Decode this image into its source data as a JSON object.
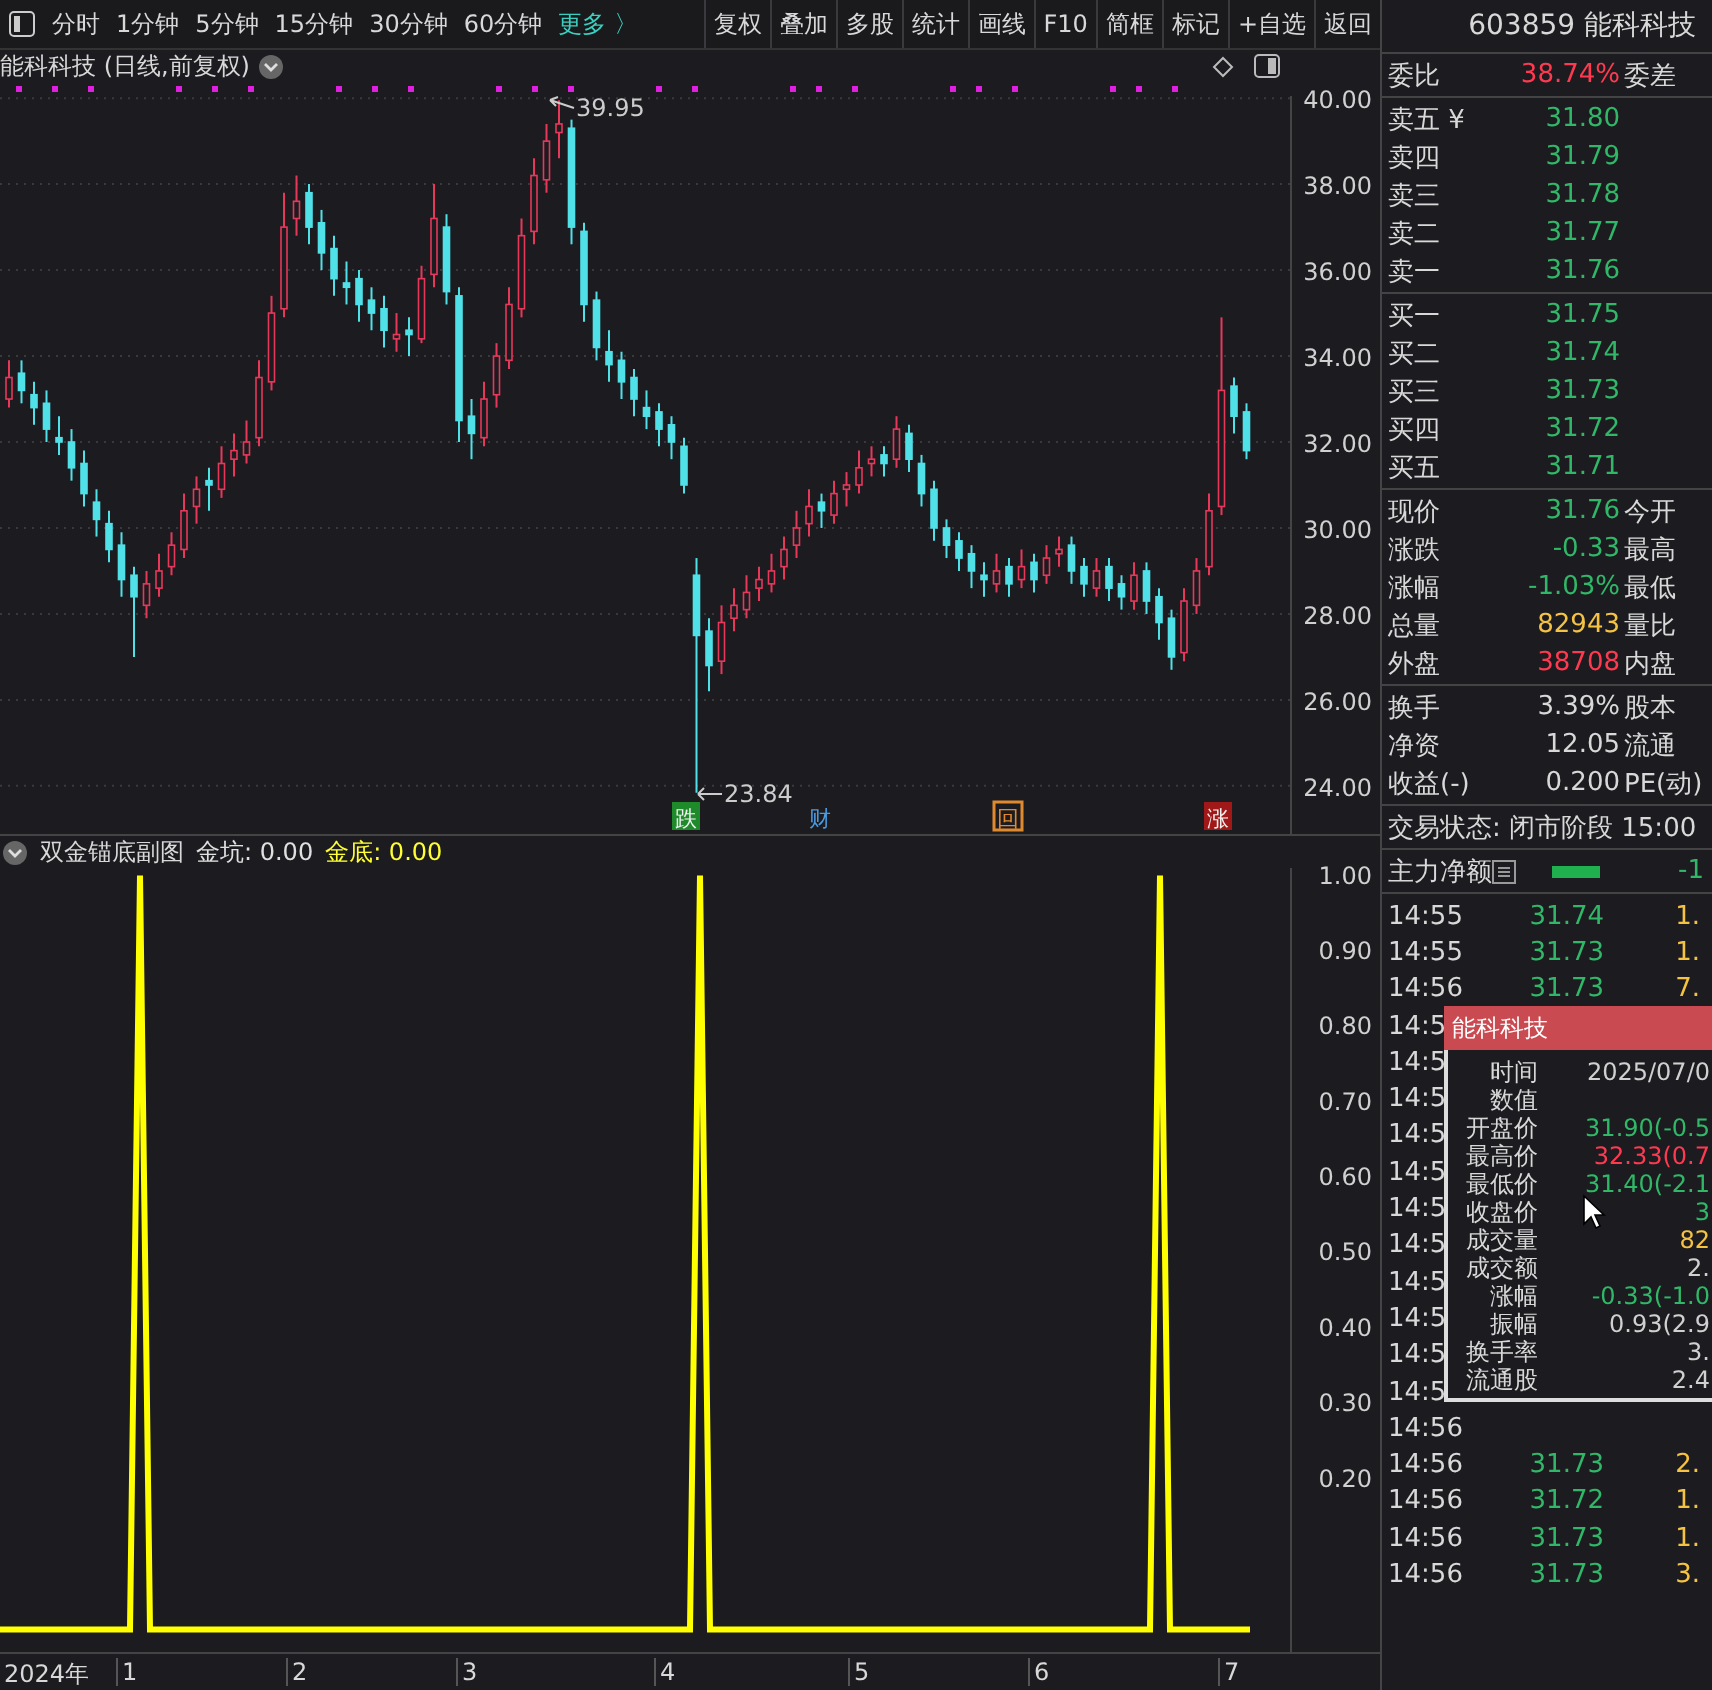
{
  "toolbar": {
    "periods": [
      {
        "label": "分时",
        "kind": "period"
      },
      {
        "label": "1分钟",
        "kind": "period"
      },
      {
        "label": "5分钟",
        "kind": "period"
      },
      {
        "label": "15分钟",
        "kind": "period"
      },
      {
        "label": "30分钟",
        "kind": "period"
      },
      {
        "label": "60分钟",
        "kind": "period"
      },
      {
        "label": "更多 〉",
        "kind": "more"
      }
    ],
    "buttons": [
      "复权",
      "叠加",
      "多股",
      "统计",
      "画线",
      "F10",
      "简框",
      "标记",
      "+自选",
      "返回"
    ]
  },
  "main_chart": {
    "title": "能科科技 (日线,前复权)",
    "high_label": "39.95",
    "low_label": "23.84",
    "chart_data": {
      "type": "candlestick",
      "ylim": [
        22.88,
        40.05
      ],
      "grid": true,
      "yticks": [
        {
          "value": 40,
          "label": "40.00"
        },
        {
          "value": 38,
          "label": "38.00"
        },
        {
          "value": 36,
          "label": "36.00"
        },
        {
          "value": 34,
          "label": "34.00"
        },
        {
          "value": 32,
          "label": "32.00"
        },
        {
          "value": 30,
          "label": "30.00"
        },
        {
          "value": 28,
          "label": "28.00"
        },
        {
          "value": 26,
          "label": "26.00"
        },
        {
          "value": 24,
          "label": "24.00"
        }
      ],
      "ohlc": [
        [
          33.0,
          33.9,
          32.8,
          33.5
        ],
        [
          33.6,
          33.9,
          32.9,
          33.2
        ],
        [
          33.1,
          33.4,
          32.4,
          32.8
        ],
        [
          32.9,
          33.2,
          32.0,
          32.3
        ],
        [
          32.1,
          32.6,
          31.7,
          32.0
        ],
        [
          32.0,
          32.3,
          31.1,
          31.4
        ],
        [
          31.5,
          31.8,
          30.5,
          30.8
        ],
        [
          30.6,
          30.9,
          29.8,
          30.2
        ],
        [
          30.1,
          30.4,
          29.2,
          29.5
        ],
        [
          29.6,
          29.9,
          28.4,
          28.8
        ],
        [
          28.9,
          29.1,
          27.0,
          28.4
        ],
        [
          28.2,
          29.0,
          27.9,
          28.7
        ],
        [
          28.6,
          29.4,
          28.4,
          29.0
        ],
        [
          29.1,
          29.9,
          28.9,
          29.6
        ],
        [
          29.5,
          30.8,
          29.3,
          30.4
        ],
        [
          30.5,
          31.2,
          30.1,
          30.9
        ],
        [
          31.1,
          31.4,
          30.4,
          31.0
        ],
        [
          30.9,
          31.9,
          30.7,
          31.5
        ],
        [
          31.6,
          32.2,
          31.2,
          31.8
        ],
        [
          31.7,
          32.5,
          31.5,
          32.0
        ],
        [
          32.1,
          33.9,
          31.9,
          33.5
        ],
        [
          33.4,
          35.4,
          33.2,
          35.0
        ],
        [
          35.1,
          37.8,
          34.9,
          37.0
        ],
        [
          37.2,
          38.2,
          36.8,
          37.6
        ],
        [
          37.8,
          38.0,
          36.6,
          37.0
        ],
        [
          37.1,
          37.4,
          36.0,
          36.4
        ],
        [
          36.5,
          36.8,
          35.4,
          35.8
        ],
        [
          35.7,
          36.2,
          35.2,
          35.6
        ],
        [
          35.8,
          36.0,
          34.8,
          35.2
        ],
        [
          35.3,
          35.6,
          34.6,
          35.0
        ],
        [
          35.1,
          35.4,
          34.2,
          34.6
        ],
        [
          34.4,
          35.0,
          34.1,
          34.5
        ],
        [
          34.6,
          34.9,
          34.0,
          34.5
        ],
        [
          34.4,
          36.1,
          34.3,
          35.8
        ],
        [
          35.9,
          38.0,
          35.6,
          37.2
        ],
        [
          37.0,
          37.3,
          35.2,
          35.5
        ],
        [
          35.4,
          35.6,
          32.0,
          32.5
        ],
        [
          32.6,
          33.0,
          31.6,
          32.2
        ],
        [
          32.1,
          33.4,
          31.9,
          33.0
        ],
        [
          33.1,
          34.3,
          32.8,
          34.0
        ],
        [
          33.9,
          35.6,
          33.7,
          35.2
        ],
        [
          35.1,
          37.2,
          34.9,
          36.8
        ],
        [
          36.9,
          38.6,
          36.6,
          38.2
        ],
        [
          38.1,
          39.4,
          37.8,
          39.0
        ],
        [
          39.2,
          39.95,
          38.6,
          39.4
        ],
        [
          39.3,
          39.5,
          36.6,
          37.0
        ],
        [
          36.9,
          37.1,
          34.8,
          35.2
        ],
        [
          35.3,
          35.5,
          33.9,
          34.2
        ],
        [
          34.1,
          34.6,
          33.4,
          33.8
        ],
        [
          33.9,
          34.1,
          33.0,
          33.4
        ],
        [
          33.5,
          33.7,
          32.6,
          33.0
        ],
        [
          32.8,
          33.2,
          32.3,
          32.6
        ],
        [
          32.7,
          32.9,
          31.9,
          32.3
        ],
        [
          32.4,
          32.6,
          31.6,
          32.0
        ],
        [
          31.9,
          32.1,
          30.8,
          31.0
        ],
        [
          28.9,
          29.3,
          23.84,
          27.5
        ],
        [
          27.6,
          27.9,
          26.2,
          26.8
        ],
        [
          26.9,
          28.2,
          26.6,
          27.8
        ],
        [
          27.9,
          28.6,
          27.6,
          28.2
        ],
        [
          28.1,
          28.9,
          27.9,
          28.5
        ],
        [
          28.6,
          29.1,
          28.3,
          28.8
        ],
        [
          28.7,
          29.4,
          28.5,
          29.0
        ],
        [
          29.1,
          29.8,
          28.8,
          29.5
        ],
        [
          29.6,
          30.4,
          29.3,
          30.0
        ],
        [
          30.1,
          30.9,
          29.8,
          30.5
        ],
        [
          30.6,
          30.8,
          30.0,
          30.4
        ],
        [
          30.3,
          31.1,
          30.1,
          30.8
        ],
        [
          30.9,
          31.3,
          30.5,
          31.0
        ],
        [
          31.0,
          31.8,
          30.8,
          31.4
        ],
        [
          31.5,
          31.9,
          31.2,
          31.6
        ],
        [
          31.7,
          31.9,
          31.2,
          31.5
        ],
        [
          31.6,
          32.6,
          31.4,
          32.3
        ],
        [
          32.2,
          32.4,
          31.3,
          31.6
        ],
        [
          31.5,
          31.7,
          30.5,
          30.8
        ],
        [
          30.9,
          31.1,
          29.7,
          30.0
        ],
        [
          30.0,
          30.2,
          29.3,
          29.6
        ],
        [
          29.7,
          29.9,
          29.0,
          29.3
        ],
        [
          29.4,
          29.6,
          28.6,
          29.0
        ],
        [
          28.9,
          29.2,
          28.4,
          28.8
        ],
        [
          28.7,
          29.4,
          28.5,
          29.0
        ],
        [
          29.1,
          29.3,
          28.4,
          28.7
        ],
        [
          28.8,
          29.5,
          28.6,
          29.1
        ],
        [
          29.2,
          29.4,
          28.5,
          28.8
        ],
        [
          28.9,
          29.6,
          28.7,
          29.3
        ],
        [
          29.4,
          29.8,
          29.1,
          29.5
        ],
        [
          29.6,
          29.8,
          28.7,
          29.0
        ],
        [
          29.1,
          29.3,
          28.4,
          28.7
        ],
        [
          28.6,
          29.3,
          28.4,
          29.0
        ],
        [
          29.1,
          29.3,
          28.3,
          28.6
        ],
        [
          28.7,
          28.9,
          28.1,
          28.4
        ],
        [
          28.3,
          29.2,
          28.1,
          28.9
        ],
        [
          29.0,
          29.2,
          28.0,
          28.3
        ],
        [
          28.4,
          28.6,
          27.4,
          27.8
        ],
        [
          27.9,
          28.1,
          26.7,
          27.0
        ],
        [
          27.1,
          28.6,
          26.9,
          28.3
        ],
        [
          28.2,
          29.3,
          28.0,
          29.0
        ],
        [
          29.1,
          30.8,
          28.9,
          30.4
        ],
        [
          30.5,
          34.9,
          30.3,
          33.2
        ],
        [
          33.3,
          33.5,
          32.2,
          32.6
        ],
        [
          32.7,
          32.9,
          31.6,
          31.8
        ]
      ]
    },
    "markers": [
      {
        "text": "跌",
        "kind": "filled",
        "color": "#1f8a2a"
      },
      {
        "text": "财",
        "kind": "text",
        "color": "#4a9be0"
      },
      {
        "text": "回",
        "kind": "outlined",
        "color": "#e08a30"
      },
      {
        "text": "涨",
        "kind": "filled",
        "color": "#a01818"
      }
    ]
  },
  "sub_chart": {
    "title": "双金锚底副图",
    "readings": [
      {
        "label": "金坑: 0.00",
        "color": "#e0e0e0"
      },
      {
        "label": "金底: 0.00",
        "color": "#ffff33"
      }
    ],
    "chart_data": {
      "type": "line",
      "ylim": [
        -0.03,
        1.01
      ],
      "yticks": [
        {
          "value": 1,
          "label": "1.00"
        },
        {
          "value": 0.9,
          "label": "0.90"
        },
        {
          "value": 0.8,
          "label": "0.80"
        },
        {
          "value": 0.7,
          "label": "0.70"
        },
        {
          "value": 0.6,
          "label": "0.60"
        },
        {
          "value": 0.5,
          "label": "0.50"
        },
        {
          "value": 0.4,
          "label": "0.40"
        },
        {
          "value": 0.3,
          "label": "0.30"
        },
        {
          "value": 0.2,
          "label": "0.20"
        }
      ],
      "series": [
        {
          "color": "#ffff00",
          "values": [
            0,
            0,
            0,
            0,
            0,
            0,
            0,
            0,
            0,
            0,
            0,
            0,
            0,
            0,
            1,
            0,
            0,
            0,
            0,
            0,
            0,
            0,
            0,
            0,
            0,
            0,
            0,
            0,
            0,
            0,
            0,
            0,
            0,
            0,
            0,
            0,
            0,
            0,
            0,
            0,
            0,
            0,
            0,
            0,
            0,
            0,
            0,
            0,
            0,
            0,
            0,
            0,
            0,
            0,
            0,
            0,
            0,
            0,
            0,
            0,
            0,
            0,
            0,
            0,
            0,
            0,
            0,
            0,
            0,
            0,
            1,
            0,
            0,
            0,
            0,
            0,
            0,
            0,
            0,
            0,
            0,
            0,
            0,
            0,
            0,
            0,
            0,
            0,
            0,
            0,
            0,
            0,
            0,
            0,
            0,
            0,
            0,
            0,
            0,
            0,
            0,
            0,
            0,
            0,
            0,
            0,
            0,
            0,
            0,
            0,
            0,
            0,
            0,
            0,
            0,
            0,
            1,
            0,
            0,
            0,
            0,
            0,
            0,
            0,
            0,
            0
          ]
        }
      ]
    },
    "time_axis": [
      "2024年",
      "1",
      "2",
      "3",
      "4",
      "5",
      "6",
      "7"
    ]
  },
  "quote": {
    "header": "603859 能科科技",
    "ratio": {
      "label": "委比",
      "value": "38.74%",
      "color": "#ff3a50",
      "label2": "委差"
    },
    "sells": [
      {
        "label": "卖五 ¥",
        "price": "31.80"
      },
      {
        "label": "卖四",
        "price": "31.79"
      },
      {
        "label": "卖三",
        "price": "31.78"
      },
      {
        "label": "卖二",
        "price": "31.77"
      },
      {
        "label": "卖一",
        "price": "31.76"
      }
    ],
    "buys": [
      {
        "label": "买一",
        "price": "31.75"
      },
      {
        "label": "买二",
        "price": "31.74"
      },
      {
        "label": "买三",
        "price": "31.73"
      },
      {
        "label": "买四",
        "price": "31.72"
      },
      {
        "label": "买五",
        "price": "31.71"
      }
    ],
    "stats": [
      {
        "label": "现价",
        "value": "31.76",
        "color": "#30b868",
        "label2": "今开"
      },
      {
        "label": "涨跌",
        "value": "-0.33",
        "color": "#30b868",
        "label2": "最高"
      },
      {
        "label": "涨幅",
        "value": "-1.03%",
        "color": "#30b868",
        "label2": "最低"
      },
      {
        "label": "总量",
        "value": "82943",
        "color": "#f5c242",
        "label2": "量比"
      },
      {
        "label": "外盘",
        "value": "38708",
        "color": "#ff3a50",
        "label2": "内盘"
      }
    ],
    "fundamentals": [
      {
        "label": "换手",
        "value": "3.39%",
        "label2": "股本"
      },
      {
        "label": "净资",
        "value": "12.05",
        "label2": "流通"
      },
      {
        "label": "收益(-)",
        "value": "0.200",
        "label2": "PE(动)"
      }
    ],
    "status": "交易状态: 闭市阶段 15:00",
    "net_flow": {
      "label": "主力净额",
      "value": "-1"
    },
    "ticks": [
      {
        "time": "14:55",
        "price": "31.74",
        "volume": "1."
      },
      {
        "time": "14:55",
        "price": "31.73",
        "volume": "1."
      },
      {
        "time": "14:56",
        "price": "31.73",
        "volume": "7."
      },
      {
        "time": "14:5"
      },
      {
        "time": "14:5"
      },
      {
        "time": "14:5"
      },
      {
        "time": "14:5"
      },
      {
        "time": "14:5"
      },
      {
        "time": "14:5"
      },
      {
        "time": "14:5"
      },
      {
        "time": "14:5"
      },
      {
        "time": "14:5"
      },
      {
        "time": "14:5"
      },
      {
        "time": "14:5"
      },
      {
        "time": "14:56"
      },
      {
        "time": "14:56",
        "price": "31.73",
        "volume": "2."
      },
      {
        "time": "14:56",
        "price": "31.72",
        "volume": "1."
      },
      {
        "time": "14:56",
        "price": "31.73",
        "volume": "1."
      },
      {
        "time": "14:56",
        "price": "31.73",
        "volume": "3."
      }
    ]
  },
  "tooltip": {
    "title": "能科科技",
    "rows": [
      {
        "label": "时间",
        "value": "2025/07/0",
        "color": "#d0d0d0"
      },
      {
        "label": "数值"
      },
      {
        "label": "开盘价",
        "value": "31.90(-0.5",
        "color": "#30b868"
      },
      {
        "label": "最高价",
        "value": "32.33(0.7",
        "color": "#ff3a50"
      },
      {
        "label": "最低价",
        "value": "31.40(-2.1",
        "color": "#30b868"
      },
      {
        "label": "收盘价",
        "value": "3",
        "color": "#30b868"
      },
      {
        "label": "成交量",
        "value": "82",
        "color": "#f5c242"
      },
      {
        "label": "成交额",
        "value": "2.",
        "color": "#d0d0d0"
      },
      {
        "label": "涨幅",
        "value": "-0.33(-1.0",
        "color": "#30b868"
      },
      {
        "label": "振幅",
        "value": "0.93(2.9",
        "color": "#d0d0d0"
      },
      {
        "label": "换手率",
        "value": "3.",
        "color": "#d0d0d0"
      },
      {
        "label": "流通股",
        "value": "2.4",
        "color": "#d0d0d0"
      }
    ]
  }
}
